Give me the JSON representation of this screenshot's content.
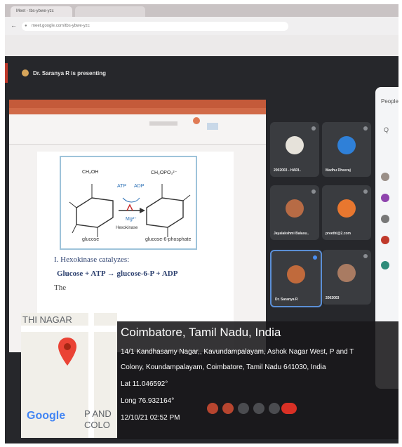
{
  "browser": {
    "tab1_label": "Meet - tbs-ybwe-yzc",
    "tab2_label": "",
    "url_text": "meet.google.com/tbs-ybwe-yzc"
  },
  "meet": {
    "presenter_banner": "Dr. Saranya R is presenting"
  },
  "slide": {
    "diagram_labels": {
      "left_ring_top": "CH₂OH",
      "right_ring_top": "CH₂OPO₃²⁻",
      "atp": "ATP",
      "adp": "ADP",
      "mg": "Mg²⁺",
      "enzyme": "Hexokinase",
      "left_name": "glucose",
      "right_name": "glucose-6-phosphate"
    },
    "heading": "I. Hexokinase catalyzes:",
    "equation": "Glucose + ATP → glucose-6-P + ADP",
    "body_fragment": "The"
  },
  "participants": [
    {
      "name": "2002003 - HARI..",
      "avatar_color": "#e6e2da"
    },
    {
      "name": "Madhu Dheeraj",
      "avatar_color": "#2f80d8"
    },
    {
      "name": "Jayalakshmi Balasu..",
      "avatar_color": "#b76b45"
    },
    {
      "name": "preethi@2.com",
      "avatar_color": "#e8772f"
    },
    {
      "name": "Dr. Saranya R",
      "avatar_color": "#c06a3c"
    },
    {
      "name": "2002003",
      "avatar_color": "#a97b62"
    }
  ],
  "side_panel": {
    "title": "People",
    "search_glyph": "Q"
  },
  "geotag": {
    "map_street": "THI NAGAR",
    "map_area_line1": "P AND",
    "map_area_line2": "COLO",
    "google_text": "Google",
    "title": "Coimbatore, Tamil Nadu, India",
    "address_line1": "14/1 Kandhasamy Nagar,, Kavundampalayam, Ashok Nagar West, P and T",
    "address_line2": "Colony, Koundampalayam, Coimbatore, Tamil Nadu 641030, India",
    "lat": "Lat 11.046592°",
    "long": "Long 76.932164°",
    "datetime": "12/10/21 02:52 PM"
  },
  "colors": {
    "google_blue": "#4285f4",
    "google_red": "#ea4335",
    "google_yellow": "#fbbc05",
    "google_green": "#34a853",
    "end_call_red": "#d93025"
  }
}
